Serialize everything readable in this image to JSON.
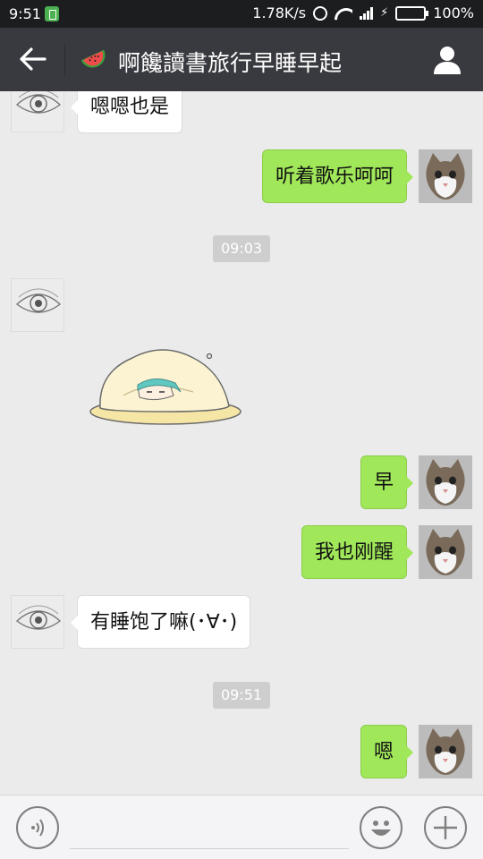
{
  "status_bar": {
    "time": "9:51",
    "network_speed": "1.78K/s",
    "battery": "100%",
    "battery_level": 1.0
  },
  "header": {
    "title": "啊饞讀書旅行早睡早起",
    "icons": [
      "back-icon",
      "watermelon-icon",
      "profile-icon"
    ]
  },
  "messages": [
    {
      "side": "left",
      "type": "text",
      "text": "嗯嗯也是"
    },
    {
      "side": "right",
      "type": "text",
      "text": "听着歌乐呵呵"
    },
    {
      "type": "time",
      "text": "09:03"
    },
    {
      "side": "left",
      "type": "sticker",
      "sticker": "sleeping-under-blanket"
    },
    {
      "side": "right",
      "type": "text",
      "text": "早"
    },
    {
      "side": "right",
      "type": "text",
      "text": "我也刚醒"
    },
    {
      "side": "left",
      "type": "text",
      "text": "有睡饱了嘛(･∀･)"
    },
    {
      "type": "time",
      "text": "09:51"
    },
    {
      "side": "right",
      "type": "text",
      "text": "嗯"
    }
  ],
  "input_bar": {
    "placeholder": "",
    "icons": [
      "voice-icon",
      "emoji-icon",
      "plus-icon"
    ]
  },
  "colors": {
    "header_bg": "#393a3f",
    "status_bg": "#1b1d1f",
    "chat_bg": "#ebebeb",
    "bubble_self": "#a0e75a",
    "bubble_other": "#ffffff"
  }
}
